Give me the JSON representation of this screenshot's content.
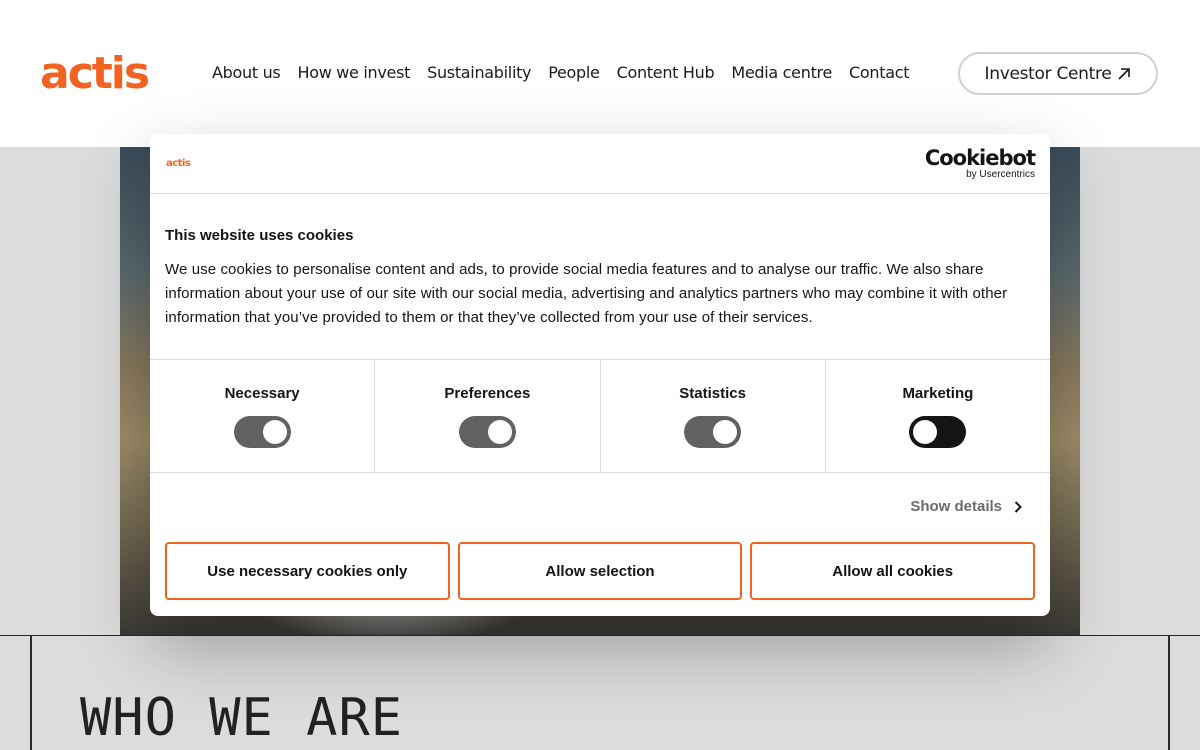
{
  "header": {
    "logo_text": "actis",
    "nav": [
      "About us",
      "How we invest",
      "Sustainability",
      "People",
      "Content Hub",
      "Media centre",
      "Contact"
    ],
    "investor_label": "Investor Centre"
  },
  "section": {
    "heading": "WHO WE ARE"
  },
  "cookie": {
    "mini_logo": "actis",
    "brand": "Cookiebot",
    "brand_sub": "by Usercentrics",
    "title": "This website uses cookies",
    "text": "We use cookies to personalise content and ads, to provide social media features and to analyse our traffic. We also share information about your use of our site with our social media, advertising and analytics partners who may combine it with other information that you’ve provided to them or that they’ve collected from your use of their services.",
    "toggles": [
      {
        "label": "Necessary",
        "on": true
      },
      {
        "label": "Preferences",
        "on": true
      },
      {
        "label": "Statistics",
        "on": true
      },
      {
        "label": "Marketing",
        "on": false
      }
    ],
    "show_details": "Show details",
    "buttons": [
      "Use necessary cookies only",
      "Allow selection",
      "Allow all cookies"
    ]
  },
  "colors": {
    "accent": "#f26321",
    "toggle_on": "#616161",
    "toggle_off": "#141414"
  }
}
